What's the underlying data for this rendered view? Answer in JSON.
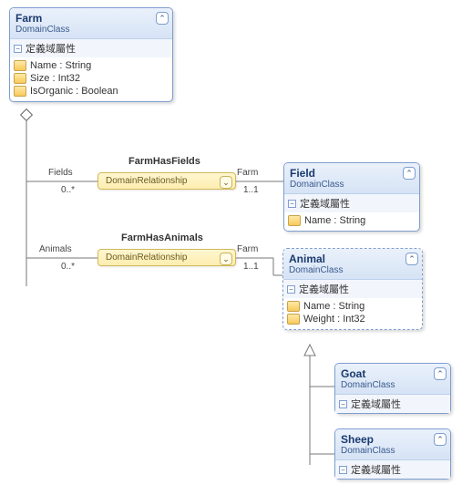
{
  "chart_data": {
    "type": "diagram",
    "classes": [
      {
        "name": "Farm",
        "stereotype": "DomainClass",
        "attrs_header": "定義域屬性",
        "attributes": [
          "Name : String",
          "Size : Int32",
          "IsOrganic : Boolean"
        ]
      },
      {
        "name": "Field",
        "stereotype": "DomainClass",
        "attrs_header": "定義域屬性",
        "attributes": [
          "Name : String"
        ]
      },
      {
        "name": "Animal",
        "stereotype": "DomainClass",
        "attrs_header": "定義域屬性",
        "attributes": [
          "Name : String",
          "Weight : Int32"
        ]
      },
      {
        "name": "Goat",
        "stereotype": "DomainClass",
        "attrs_header": "定義域屬性",
        "attributes": []
      },
      {
        "name": "Sheep",
        "stereotype": "DomainClass",
        "attrs_header": "定義域屬性",
        "attributes": []
      }
    ],
    "relationships": [
      {
        "name": "FarmHasFields",
        "stereotype": "DomainRelationship",
        "ends": [
          {
            "role": "Fields",
            "mult": "0..*"
          },
          {
            "role": "Farm",
            "mult": "1..1"
          }
        ]
      },
      {
        "name": "FarmHasAnimals",
        "stereotype": "DomainRelationship",
        "ends": [
          {
            "role": "Animals",
            "mult": "0..*"
          },
          {
            "role": "Farm",
            "mult": "1..1"
          }
        ]
      }
    ],
    "inheritance": [
      {
        "sub": "Goat",
        "super": "Animal"
      },
      {
        "sub": "Sheep",
        "super": "Animal"
      }
    ]
  }
}
